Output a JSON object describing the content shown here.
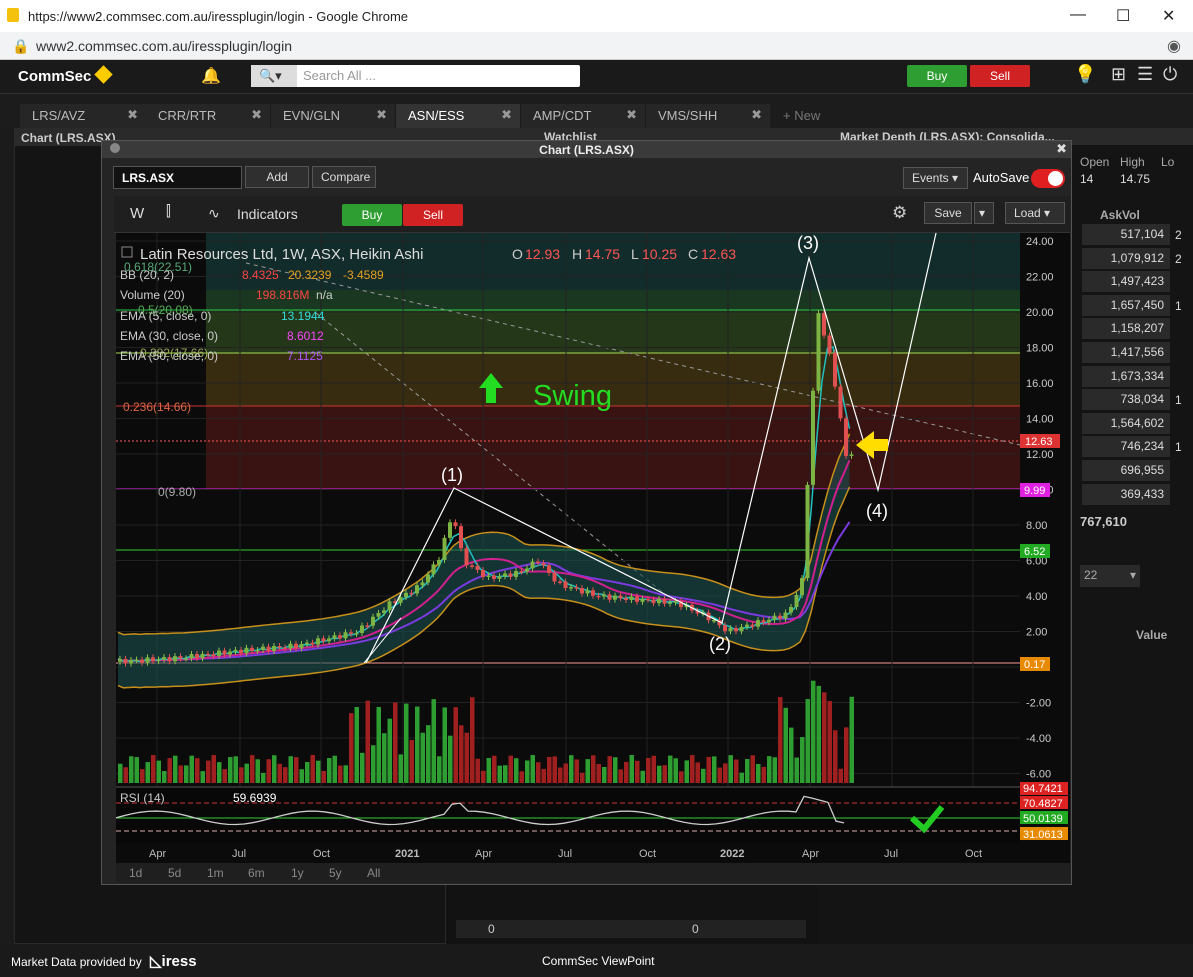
{
  "browser": {
    "title": "https://www2.commsec.com.au/iressplugin/login - Google Chrome",
    "url": "www2.commsec.com.au/iressplugin/login"
  },
  "app": {
    "brand": "CommSec",
    "search_placeholder": "Search All ...",
    "buy": "Buy",
    "sell": "Sell"
  },
  "tabs": [
    {
      "label": "LRS/AVZ"
    },
    {
      "label": "CRR/RTR"
    },
    {
      "label": "EVN/GLN"
    },
    {
      "label": "ASN/ESS"
    },
    {
      "label": "AMP/CDT"
    },
    {
      "label": "VMS/SHH"
    },
    {
      "label": "+ New"
    }
  ],
  "panels": {
    "left_title": "Chart (LRS.ASX)",
    "watchlist": "Watchlist",
    "depth_title": "Market Depth (LRS.ASX): Consolida...",
    "open_label": "Open",
    "open_val": "14",
    "high_label": "High",
    "high_val": "14.75",
    "lo_label": "Lo",
    "askvol": "AskVol",
    "total": "767,610",
    "value_label": "Value",
    "date_sel": "22",
    "zero1": "0",
    "zero2": "0"
  },
  "depth": [
    "517,104",
    "1,079,912",
    "1,497,423",
    "1,657,450",
    "1,158,207",
    "1,417,556",
    "1,673,334",
    "738,034",
    "1,564,602",
    "746,234",
    "696,955",
    "369,433"
  ],
  "depth_side": [
    "2",
    "2",
    "",
    "1",
    "",
    "",
    "",
    "1",
    "",
    "1",
    "",
    ""
  ],
  "chartwin": {
    "title": "Chart (LRS.ASX)",
    "symbol": "LRS.ASX",
    "add": "Add",
    "compare": "Compare",
    "events": "Events",
    "autosave": "AutoSave",
    "interval": "W",
    "indicators": "Indicators",
    "buy": "Buy",
    "sell": "Sell",
    "save": "Save",
    "load": "Load"
  },
  "legend": {
    "title": "Latin Resources Ltd, 1W, ASX, Heikin Ashi",
    "o": "O",
    "o_val": "12.93",
    "h": "H",
    "h_val": "14.75",
    "l": "L",
    "l_val": "10.25",
    "c": "C",
    "c_val": "12.63",
    "bb": "BB (20, 2)",
    "bb1": "8.4325",
    "bb2": "20.3239",
    "bb3": "-3.4589",
    "vol": "Volume (20)",
    "vol_val": "198.816M",
    "vol_na": "n/a",
    "ema5": "EMA (5, close, 0)",
    "ema5v": "13.1944",
    "ema30": "EMA (30, close, 0)",
    "ema30v": "8.6012",
    "ema50": "EMA (50, close, 0)",
    "ema50v": "7.1125",
    "rsi": "RSI (14)",
    "rsi_val": "59.6939"
  },
  "annotations": {
    "swing": "Swing",
    "w1": "(1)",
    "w2": "(2)",
    "w3": "(3)",
    "w4": "(4)",
    "fib0618": "0.618(22.51)",
    "fib05": "0.5(20.08)",
    "fib0382": "0.382(17.66)",
    "fib0236": "0.236(14.66)",
    "fib0": "0(9.80)"
  },
  "yaxis": [
    "24.00",
    "22.00",
    "20.00",
    "18.00",
    "16.00",
    "14.00",
    "12.00",
    "10.00",
    "8.00",
    "6.00",
    "4.00",
    "2.00",
    "0.00",
    "-2.00",
    "-4.00",
    "-6.00"
  ],
  "price_tags": {
    "last": "12.63",
    "pink": "9.99",
    "green": "6.52",
    "orange": "0.17"
  },
  "rsi_tags": [
    "94.7421",
    "70.4827",
    "50.0139",
    "31.0613"
  ],
  "xaxis": [
    "Apr",
    "Jul",
    "Oct",
    "2021",
    "Apr",
    "Jul",
    "Oct",
    "2022",
    "Apr",
    "Jul",
    "Oct"
  ],
  "ranges": [
    "1d",
    "5d",
    "1m",
    "6m",
    "1y",
    "5y",
    "All"
  ],
  "footer": {
    "provided": "Market Data provided by",
    "iress": "iress",
    "viewpoint": "CommSec ViewPoint"
  }
}
